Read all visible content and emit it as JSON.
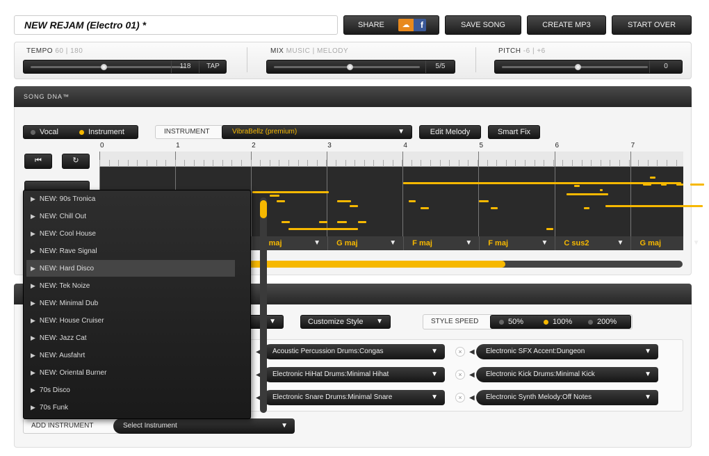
{
  "song_title": "NEW REJAM (Electro 01) *",
  "toolbar": {
    "share_label": "SHARE",
    "share_badge_text": "f",
    "save_label": "SAVE SONG",
    "mp3_label": "CREATE MP3",
    "start_over_label": "START OVER"
  },
  "controls": {
    "tempo": {
      "label": "TEMPO",
      "range": "60 | 180",
      "value": "118",
      "tap_label": "TAP",
      "level": 0.48
    },
    "mix": {
      "label": "MIX",
      "range": "MUSIC | MELODY",
      "value": "5/5",
      "level": 0.5
    },
    "pitch": {
      "label": "PITCH",
      "range": "-6 | +6",
      "value": "0",
      "level": 0.5
    }
  },
  "song_dna": {
    "header": "SONG DNA™",
    "vocal_label": "Vocal",
    "instrument_label": "Instrument",
    "instrument_field_label": "INSTRUMENT",
    "instrument_value": "VibraBellz (premium)",
    "edit_melody_label": "Edit Melody",
    "smart_fix_label": "Smart Fix",
    "measures": [
      "0",
      "1",
      "2",
      "3",
      "4",
      "5",
      "6",
      "7"
    ],
    "chords": [
      "G maj",
      "G maj",
      "F maj",
      "F maj",
      "C sus2",
      "G maj"
    ],
    "progress": 0.6
  },
  "style": {
    "customize_label": "Customize Style",
    "speed_label": "STYLE SPEED",
    "speeds": [
      "50%",
      "100%",
      "200%"
    ],
    "selected_speed": "100%"
  },
  "tracks": [
    "Acoustic Percussion Drums:Congas",
    "Electronic SFX Accent:Dungeon",
    "Electronic HiHat Drums:Minimal Hihat",
    "Electronic Kick Drums:Minimal Kick",
    "Electronic Snare Drums:Minimal Snare",
    "Electronic Synth Melody:Off Notes"
  ],
  "add_instrument": {
    "label": "ADD INSTRUMENT",
    "placeholder": "Select Instrument"
  },
  "style_dropdown": {
    "items": [
      "NEW: 90s Tronica",
      "NEW: Chill Out",
      "NEW: Cool House",
      "NEW: Rave Signal",
      "NEW: Hard Disco",
      "NEW: Tek Noize",
      "NEW: Minimal Dub",
      "NEW: House Cruiser",
      "NEW: Jazz Cat",
      "NEW: Ausfahrt",
      "NEW: Oriental Burner",
      "70s Disco",
      "70s Funk"
    ],
    "highlighted": "NEW: Hard Disco"
  },
  "colors": {
    "accent": "#f6b800",
    "dark": "#1c1c1c"
  }
}
